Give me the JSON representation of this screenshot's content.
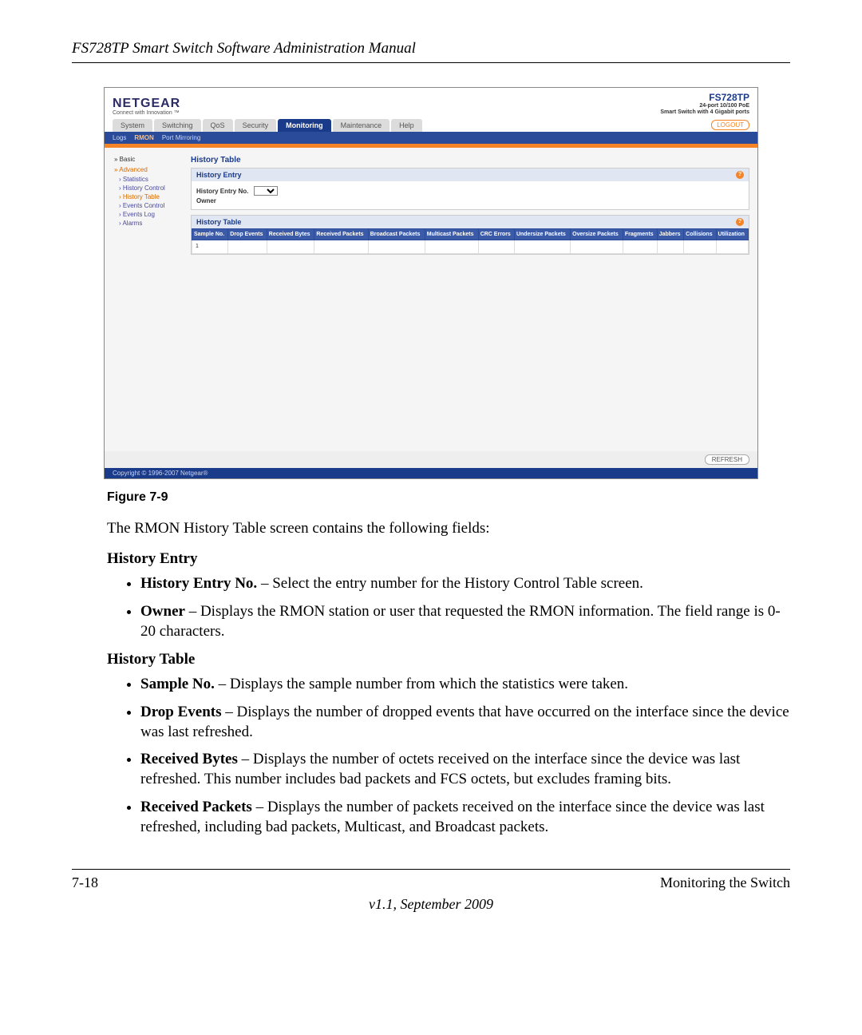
{
  "doc": {
    "header_title": "FS728TP Smart Switch Software Administration Manual",
    "figure_caption": "Figure 7-9",
    "intro_line": "The RMON History Table screen contains the following fields:",
    "section1_title": "History Entry",
    "section1_items": [
      {
        "term": "History Entry No.",
        "desc": " – Select the entry number for the History Control Table screen."
      },
      {
        "term": "Owner",
        "desc": " – Displays the RMON station or user that requested the RMON information. The field range is 0-20 characters."
      }
    ],
    "section2_title": "History Table",
    "section2_items": [
      {
        "term": "Sample No.",
        "desc": " – Displays the sample number from which the statistics were taken."
      },
      {
        "term": "Drop Events",
        "desc": " – Displays the number of dropped events that have occurred on the interface since the device was last refreshed."
      },
      {
        "term": "Received Bytes",
        "desc": " – Displays the number of octets received on the interface since the device was last refreshed. This number includes bad packets and FCS octets, but excludes framing bits."
      },
      {
        "term": "Received Packets",
        "desc": " – Displays the number of packets received on the interface since the device was last refreshed, including bad packets, Multicast, and Broadcast packets."
      }
    ],
    "footer_left": "7-18",
    "footer_right": "Monitoring the Switch",
    "version": "v1.1, September 2009"
  },
  "ui": {
    "brand": "NETGEAR",
    "brand_tag": "Connect with Innovation ™",
    "product_model": "FS728TP",
    "product_desc1": "24-port 10/100 PoE",
    "product_desc2": "Smart Switch with 4 Gigabit ports",
    "logout": "LOGOUT",
    "main_tabs": [
      "System",
      "Switching",
      "QoS",
      "Security",
      "Monitoring",
      "Maintenance",
      "Help"
    ],
    "main_tab_active": "Monitoring",
    "sub_tabs": [
      "Logs",
      "RMON",
      "Port Mirroring"
    ],
    "sub_tab_active": "RMON",
    "sidebar": {
      "basic": "Basic",
      "advanced": "Advanced",
      "items": [
        "Statistics",
        "History Control",
        "History Table",
        "Events Control",
        "Events Log",
        "Alarms"
      ],
      "active": "History Table"
    },
    "panel": {
      "title": "History Table",
      "entry_card_title": "History Entry",
      "entry_no_label": "History Entry No.",
      "owner_label": "Owner",
      "table_card_title": "History Table",
      "columns": [
        "Sample No.",
        "Drop Events",
        "Received Bytes",
        "Received Packets",
        "Broadcast Packets",
        "Multicast Packets",
        "CRC Errors",
        "Undersize Packets",
        "Oversize Packets",
        "Fragments",
        "Jabbers",
        "Collisions",
        "Utilization"
      ],
      "row1_sample": "1"
    },
    "refresh": "REFRESH",
    "copyright": "Copyright © 1996-2007 Netgear®"
  }
}
